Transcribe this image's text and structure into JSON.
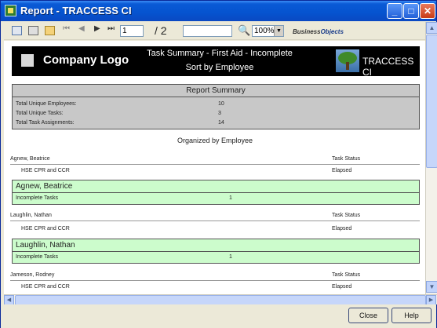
{
  "window": {
    "title": "Report - TRACCESS CI"
  },
  "title_buttons": {
    "minimize": "_",
    "maximize": "□",
    "close": "✕"
  },
  "toolbar": {
    "page_current": "1",
    "page_total": "/ 2",
    "search_value": "",
    "zoom": "100%",
    "brand_prefix": "Business",
    "brand_suffix": "Objects",
    "nav_first": "⏮",
    "nav_prev": "◀",
    "nav_next": "▶",
    "nav_last": "⏭",
    "find_glyph": "🔍"
  },
  "report": {
    "company_logo": "Company Logo",
    "title": "Task Summary - First Aid - Incomplete",
    "subtitle": "Sort by Employee",
    "brand": "TRACCESS CI",
    "summary": {
      "heading": "Report Summary",
      "rows": [
        {
          "label": "Total Unique Employees:",
          "value": "10"
        },
        {
          "label": "Total Unique Tasks:",
          "value": "3"
        },
        {
          "label": "Total Task Assignments:",
          "value": "14"
        }
      ]
    },
    "organized_label": "Organized by Employee",
    "status_header": "Task Status",
    "employees": [
      {
        "name": "Agnew, Beatrice",
        "task": "HSE  CPR and CCR",
        "status": "Elapsed",
        "group_label": "Incomplete Tasks",
        "count": "1"
      },
      {
        "name": "Laughlin, Nathan",
        "task": "HSE  CPR and CCR",
        "status": "Elapsed",
        "group_label": "Incomplete Tasks",
        "count": "1"
      },
      {
        "name": "Jameson, Rodney",
        "task": "HSE  CPR and CCR",
        "status": "Elapsed"
      }
    ]
  },
  "buttons": {
    "close": "Close",
    "help": "Help"
  }
}
